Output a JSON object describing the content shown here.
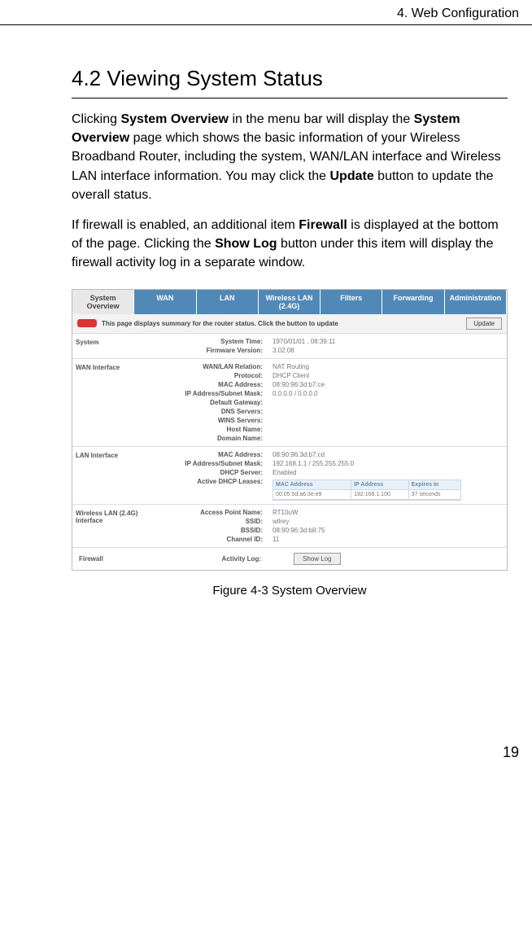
{
  "header": {
    "chapter": "4. Web Configuration"
  },
  "section": {
    "title": "4.2 Viewing System Status"
  },
  "paragraphs": {
    "p1_a": "Clicking ",
    "p1_b": "System Overview",
    "p1_c": " in the menu bar will display the ",
    "p1_d": "System Overview",
    "p1_e": " page which shows the basic information of your Wireless Broadband Router, including the system, WAN/LAN interface and Wireless LAN interface information. You may click the ",
    "p1_f": "Update",
    "p1_g": " button to update the overall status.",
    "p2_a": "If firewall is enabled, an additional item ",
    "p2_b": "Firewall",
    "p2_c": " is displayed at the bottom of the page. Clicking the ",
    "p2_d": "Show Log",
    "p2_e": " button under this item will display the firewall activity log in a separate window."
  },
  "figure": {
    "caption": "Figure 4-3    System Overview"
  },
  "router": {
    "tabs": {
      "t0": "System Overview",
      "t1": "WAN",
      "t2": "LAN",
      "t3": "Wireless LAN (2.4G)",
      "t4": "Filters",
      "t5": "Forwarding",
      "t6": "Administration"
    },
    "summary_text": "This page displays summary for the router status. Click the button to update",
    "update_btn": "Update",
    "system": {
      "label": "System",
      "keys": {
        "k0": "System Time:",
        "k1": "Firmware Version:"
      },
      "vals": {
        "v0": "1970/01/01 , 08:39:11",
        "v1": "3.02.08"
      }
    },
    "wan": {
      "label": "WAN Interface",
      "keys": {
        "k0": "WAN/LAN Relation:",
        "k1": "Protocol:",
        "k2": "MAC Address:",
        "k3": "IP Address/Subnet Mask:",
        "k4": "Default Gateway:",
        "k5": "DNS Servers:",
        "k6": "WINS Servers:",
        "k7": "Host Name:",
        "k8": "Domain Name:"
      },
      "vals": {
        "v0": "NAT Routing",
        "v1": "DHCP Client",
        "v2": "08:90:96:3d:b7:ce",
        "v3": "0.0.0.0 / 0.0.0.0",
        "v4": "",
        "v5": "",
        "v6": "",
        "v7": "",
        "v8": ""
      }
    },
    "lan": {
      "label": "LAN Interface",
      "keys": {
        "k0": "MAC Address:",
        "k1": "IP Address/Subnet Mask:",
        "k2": "DHCP Server:",
        "k3": "Active DHCP Leases:"
      },
      "vals": {
        "v0": "08:90:96:3d:b7:cd",
        "v1": "192.168.1.1 / 255.255.255.0",
        "v2": "Enabled"
      },
      "lease_head": {
        "h0": "MAC Address",
        "h1": "IP Address",
        "h2": "Expires In"
      },
      "lease_row": {
        "c0": "00:05:5d:a6:3e:e9",
        "c1": "192.168.1.100",
        "c2": "37 seconds"
      }
    },
    "wlan": {
      "label": "Wireless LAN (2.4G) Interface",
      "keys": {
        "k0": "Access Point Name:",
        "k1": "SSID:",
        "k2": "BSSID:",
        "k3": "Channel ID:"
      },
      "vals": {
        "v0": "RT10uW",
        "v1": "wilrey",
        "v2": "08:90:96:3d:b8:75",
        "v3": "11"
      }
    },
    "firewall": {
      "label": "Firewall",
      "key": "Activity Log:",
      "btn": "Show Log"
    }
  },
  "page_number": "19"
}
